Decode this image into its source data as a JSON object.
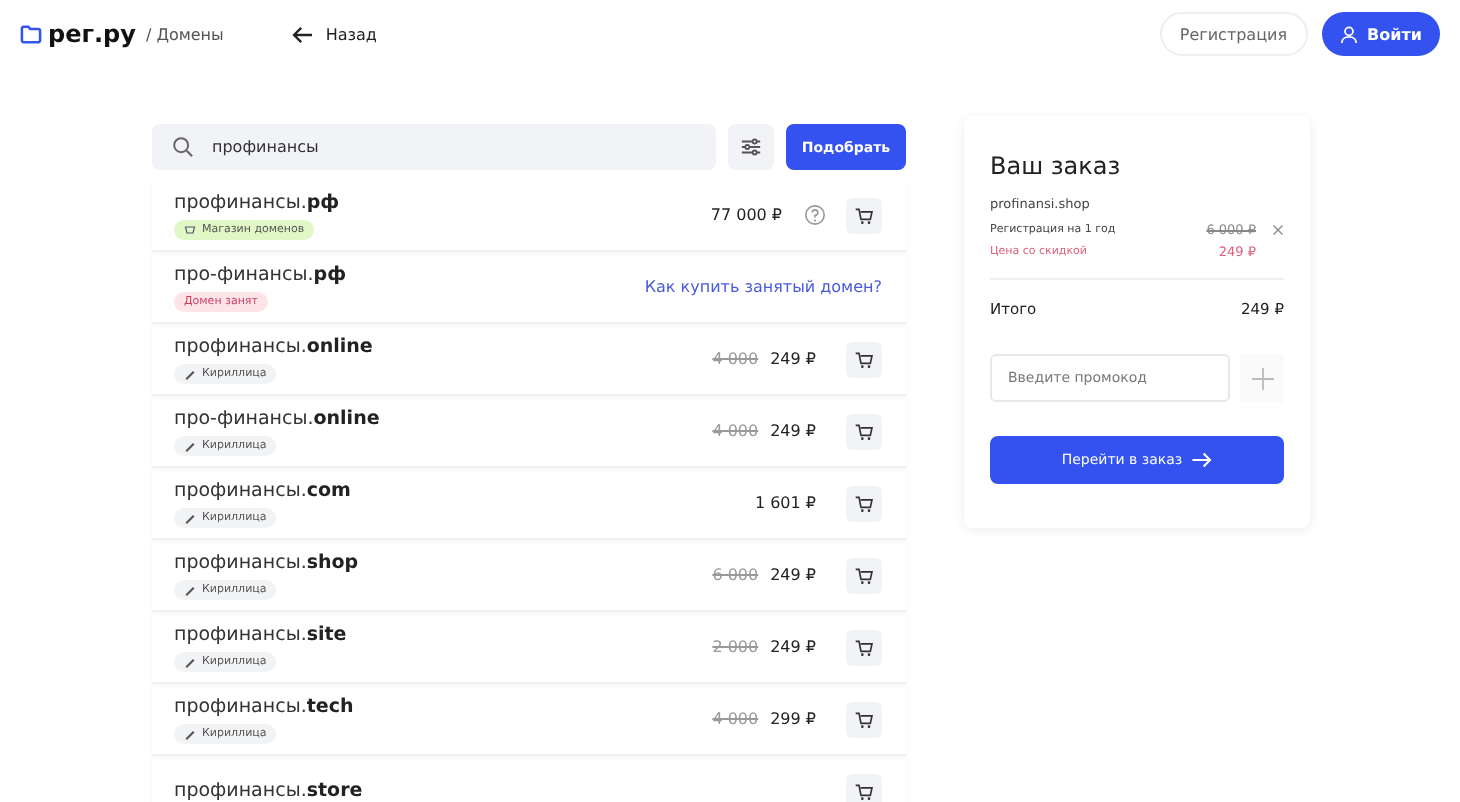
{
  "header": {
    "logo": "рег.ру",
    "breadcrumb": "/ Домены",
    "back": "Назад",
    "register_button": "Регистрация",
    "login_button": "Войти"
  },
  "search": {
    "value": "профинансы",
    "submit": "Подобрать"
  },
  "results": [
    {
      "name": "профинансы.**рф**",
      "tag": {
        "kind": "shop",
        "label": "Магазин доменов"
      },
      "price": "77 000 ₽",
      "help": true
    },
    {
      "name": "про-финансы.**рф**",
      "tag": {
        "kind": "taken",
        "label": "Домен занят"
      },
      "link": "Как купить занятый домен?"
    },
    {
      "name": "профинансы.**online**",
      "tag": {
        "kind": "cyrillic",
        "label": "Кириллица"
      },
      "old_price": "4 000",
      "price": "249 ₽"
    },
    {
      "name": "про-финансы.**online**",
      "tag": {
        "kind": "cyrillic",
        "label": "Кириллица"
      },
      "old_price": "4 000",
      "price": "249 ₽"
    },
    {
      "name": "профинансы.**com**",
      "tag": {
        "kind": "cyrillic",
        "label": "Кириллица"
      },
      "price": "1 601 ₽"
    },
    {
      "name": "профинансы.**shop**",
      "tag": {
        "kind": "cyrillic",
        "label": "Кириллица"
      },
      "old_price": "6 000",
      "price": "249 ₽"
    },
    {
      "name": "профинансы.**site**",
      "tag": {
        "kind": "cyrillic",
        "label": "Кириллица"
      },
      "old_price": "2 000",
      "price": "249 ₽"
    },
    {
      "name": "профинансы.**tech**",
      "tag": {
        "kind": "cyrillic",
        "label": "Кириллица"
      },
      "old_price": "4 000",
      "price": "299 ₽"
    },
    {
      "name": "профинансы.**store**"
    }
  ],
  "order": {
    "title": "Ваш заказ",
    "domain": "profinansi.shop",
    "registration_label": "Регистрация на 1 год",
    "registration_price": "6 000 ₽",
    "discount_label": "Цена со скидкой",
    "discount_price": "249 ₽",
    "total_label": "Итого",
    "total": "249 ₽",
    "promo_placeholder": "Введите промокод",
    "checkout": "Перейти в заказ"
  }
}
